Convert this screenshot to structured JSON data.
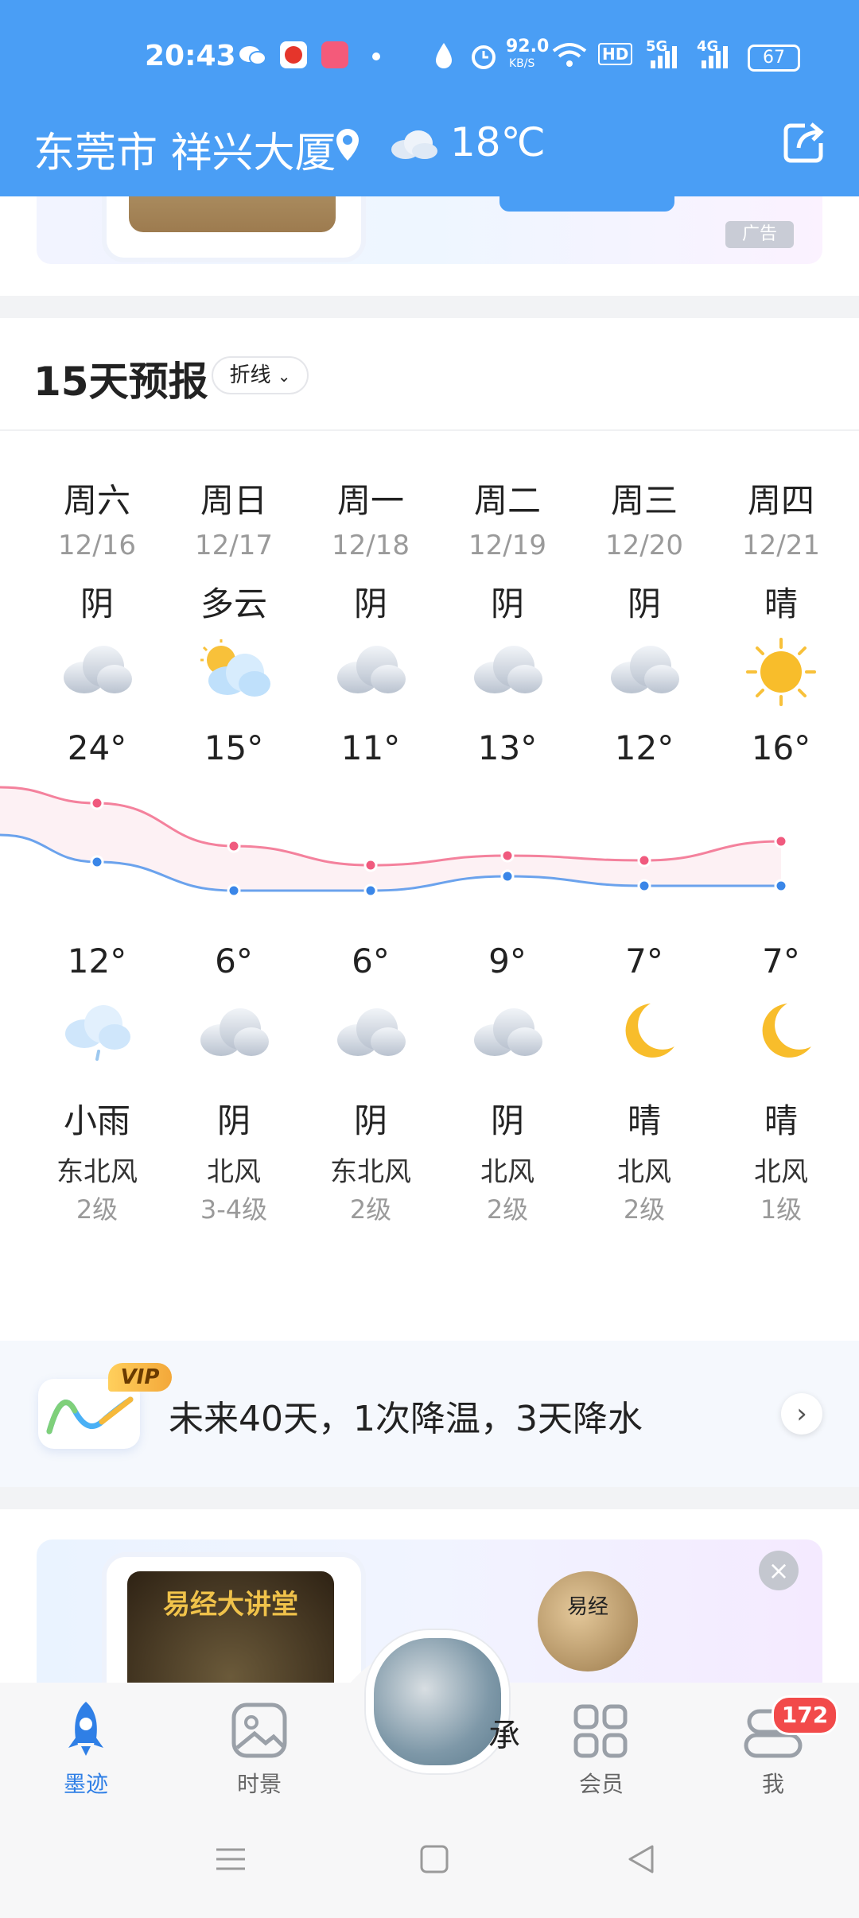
{
  "status_bar": {
    "time": "20:43",
    "speed": "92.0",
    "speed_unit": "KB/S",
    "battery": "67",
    "net1": "5G",
    "net2": "4G",
    "hd": "HD"
  },
  "header": {
    "location": "东莞市 祥兴大厦",
    "current_temp": "18℃"
  },
  "ad_top": {
    "tag": "广告"
  },
  "forecast": {
    "title": "15天预报",
    "toggle_label": "折线",
    "days": [
      {
        "weekday": "周六",
        "date": "12/16",
        "day_cond": "阴",
        "day_icon": "cloudy-icon",
        "high": "24°",
        "low": "12°",
        "night_icon": "light-rain-icon",
        "night_cond": "小雨",
        "wind": "东北风",
        "level": "2级"
      },
      {
        "weekday": "周日",
        "date": "12/17",
        "day_cond": "多云",
        "day_icon": "partly-cloudy-icon",
        "high": "15°",
        "low": "6°",
        "night_icon": "cloudy-icon",
        "night_cond": "阴",
        "wind": "北风",
        "level": "3-4级"
      },
      {
        "weekday": "周一",
        "date": "12/18",
        "day_cond": "阴",
        "day_icon": "cloudy-icon",
        "high": "11°",
        "low": "6°",
        "night_icon": "cloudy-icon",
        "night_cond": "阴",
        "wind": "东北风",
        "level": "2级"
      },
      {
        "weekday": "周二",
        "date": "12/19",
        "day_cond": "阴",
        "day_icon": "cloudy-icon",
        "high": "13°",
        "low": "9°",
        "night_icon": "cloudy-icon",
        "night_cond": "阴",
        "wind": "北风",
        "level": "2级"
      },
      {
        "weekday": "周三",
        "date": "12/20",
        "day_cond": "阴",
        "day_icon": "cloudy-icon",
        "high": "12°",
        "low": "7°",
        "night_icon": "moon-icon",
        "night_cond": "晴",
        "wind": "北风",
        "level": "2级"
      },
      {
        "weekday": "周四",
        "date": "12/21",
        "day_cond": "晴",
        "day_icon": "sun-icon",
        "high": "16°",
        "low": "7°",
        "night_icon": "moon-icon",
        "night_cond": "晴",
        "wind": "北风",
        "level": "1级"
      }
    ],
    "chart_data": {
      "type": "line",
      "categories": [
        "12/16",
        "12/17",
        "12/18",
        "12/19",
        "12/20",
        "12/21"
      ],
      "series": [
        {
          "values": [
            24,
            15,
            11,
            13,
            12,
            16
          ],
          "color": "#f05a7e"
        },
        {
          "values": [
            12,
            6,
            6,
            9,
            7,
            7
          ],
          "color": "#3a86e8"
        }
      ]
    }
  },
  "vip": {
    "badge": "VIP",
    "text": "未来40天，1次降温，3天降水"
  },
  "ad_low": {
    "book_title": "易经大讲堂",
    "avatar_text": "易经"
  },
  "nav": {
    "items": [
      {
        "label": "墨迹"
      },
      {
        "label": "时景"
      },
      {
        "label": "会员"
      },
      {
        "label": "我"
      }
    ],
    "badge": "172",
    "partial": "承"
  },
  "colors": {
    "header_bg": "#4a9ef5",
    "high_line": "#f05a7e",
    "low_line": "#3a86e8",
    "active_nav": "#2f7fe6"
  }
}
